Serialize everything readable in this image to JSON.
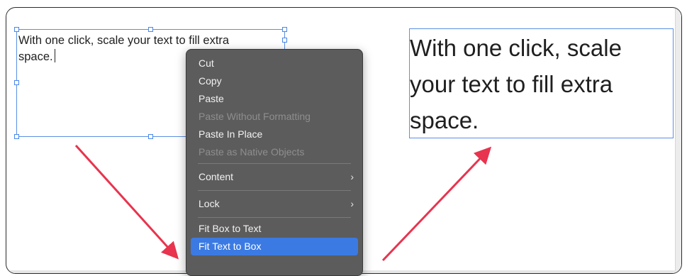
{
  "left_textbox": {
    "text": "With one click, scale your text to fill extra space."
  },
  "right_textbox": {
    "text": "With one click, scale your text to fill extra space."
  },
  "context_menu": {
    "items": [
      {
        "label": "Cut",
        "enabled": true
      },
      {
        "label": "Copy",
        "enabled": true
      },
      {
        "label": "Paste",
        "enabled": true
      },
      {
        "label": "Paste Without Formatting",
        "enabled": false
      },
      {
        "label": "Paste In Place",
        "enabled": true
      },
      {
        "label": "Paste as Native Objects",
        "enabled": false
      },
      {
        "label": "Content",
        "enabled": true,
        "submenu": true
      },
      {
        "label": "Lock",
        "enabled": true,
        "submenu": true
      },
      {
        "label": "Fit Box to Text",
        "enabled": true
      },
      {
        "label": "Fit Text to Box",
        "enabled": true,
        "highlighted": true
      }
    ],
    "submenu_glyph": "›"
  },
  "colors": {
    "selection_border": "#5b8fe3",
    "menu_background": "#5c5c5c",
    "menu_highlight": "#3b7ae3",
    "arrow": "#e8344e"
  },
  "icons": [
    "chevron-right-icon",
    "arrow-icon",
    "text-caret-icon"
  ]
}
